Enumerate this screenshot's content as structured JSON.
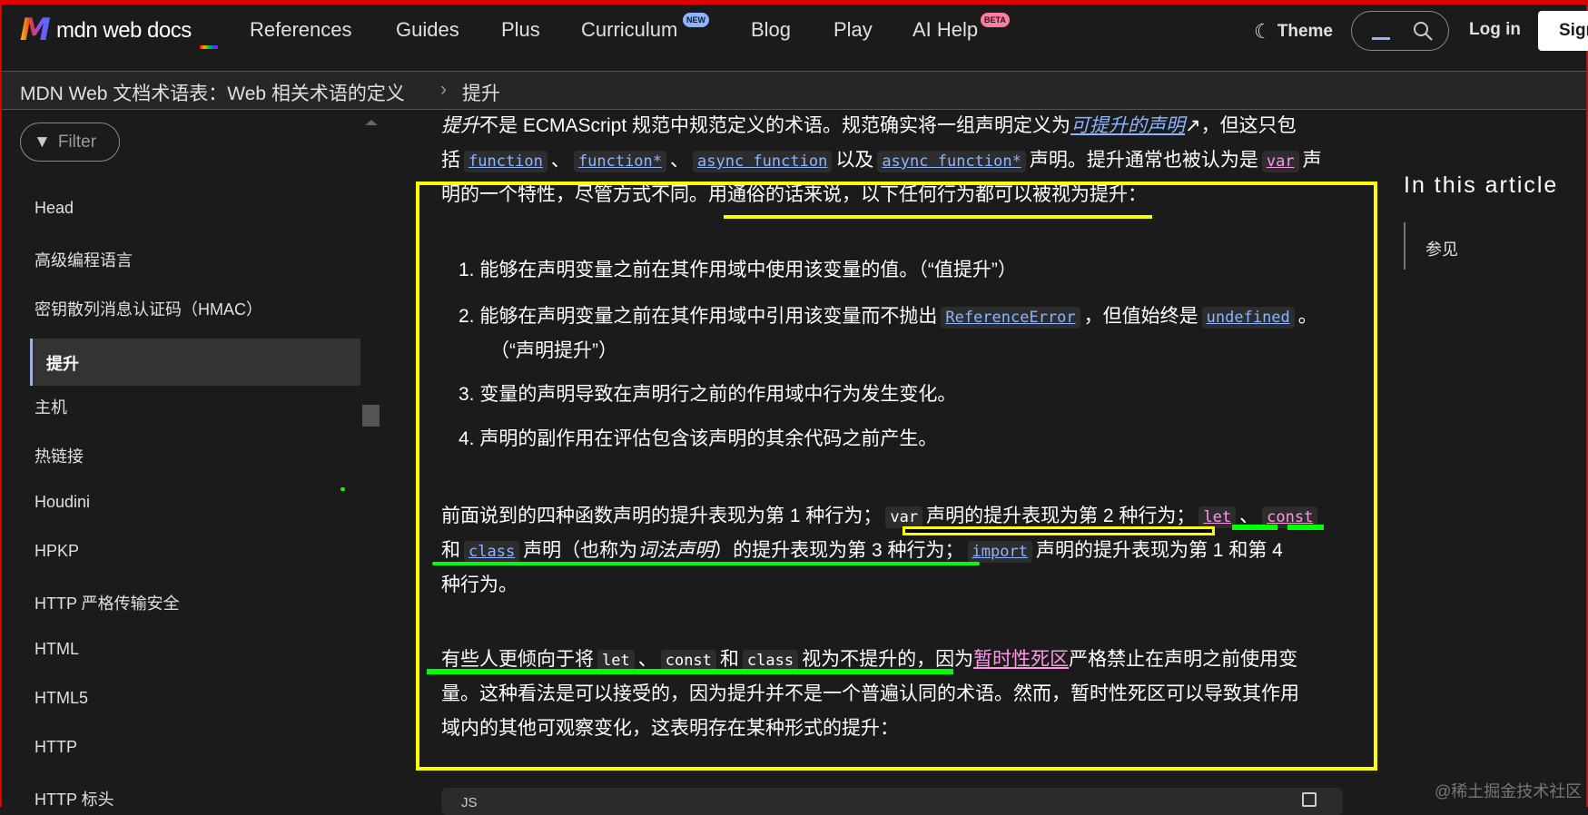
{
  "header": {
    "logo": "mdn web docs",
    "nav": [
      {
        "label": "References"
      },
      {
        "label": "Guides"
      },
      {
        "label": "Plus"
      },
      {
        "label": "Curriculum",
        "badge": "NEW"
      },
      {
        "label": "Blog"
      },
      {
        "label": "Play"
      },
      {
        "label": "AI Help",
        "badge": "BETA"
      }
    ],
    "theme_label": "Theme",
    "login_label": "Log in",
    "signup_label": "Sign"
  },
  "breadcrumb": {
    "parent": "MDN Web 文档术语表：Web 相关术语的定义",
    "separator": "›",
    "current": "提升"
  },
  "sidebar": {
    "filter_label": "Filter",
    "items": [
      "Head",
      "高级编程语言",
      "密钥散列消息认证码（HMAC）",
      "提升",
      "主机",
      "热链接",
      "Houdini",
      "HPKP",
      "HTTP 严格传输安全",
      "HTML",
      "HTML5",
      "HTTP",
      "HTTP 标头"
    ],
    "active_index": 3
  },
  "article": {
    "lines": [
      {
        "cls": "",
        "seg": [
          [
            "em",
            "提升"
          ],
          [
            "t",
            "不是 ECMAScript 规范中规范定义的术语。规范确实将一组声明定义为"
          ],
          [
            "link",
            "可提升的声明"
          ],
          [
            "t",
            "↗，但这只包"
          ]
        ]
      },
      {
        "cls": "",
        "seg": [
          [
            "t",
            "括"
          ],
          [
            "code-l",
            "function"
          ],
          [
            "t",
            "、"
          ],
          [
            "code-l",
            "function*"
          ],
          [
            "t",
            "、"
          ],
          [
            "code-l",
            "async function"
          ],
          [
            "t",
            "以及"
          ],
          [
            "code-l",
            "async function*"
          ],
          [
            "t",
            "声明。提升通常也被认为是"
          ],
          [
            "code-p",
            "var"
          ],
          [
            "t",
            "声"
          ]
        ]
      },
      {
        "cls": "",
        "seg": [
          [
            "t",
            "明的一个特性，尽管方式不同。用通俗的话来说，以下任何行为都可以被视为提升："
          ]
        ]
      },
      {
        "cls": "li",
        "seg": [
          [
            "t",
            "1. 能够在声明变量之前在其作用域中使用该变量的值。（“值提升”）"
          ]
        ]
      },
      {
        "cls": "li",
        "seg": [
          [
            "t",
            "2. 能够在声明变量之前在其作用域中引用该变量而不抛出"
          ],
          [
            "code-l",
            "ReferenceError"
          ],
          [
            "t",
            "，但值始终是"
          ],
          [
            "code-l",
            "undefined"
          ],
          [
            "t",
            "。"
          ]
        ]
      },
      {
        "cls": "li2",
        "seg": [
          [
            "t",
            "（“声明提升”）"
          ]
        ]
      },
      {
        "cls": "li",
        "seg": [
          [
            "t",
            "3. 变量的声明导致在声明行之前的作用域中行为发生变化。"
          ]
        ]
      },
      {
        "cls": "li",
        "seg": [
          [
            "t",
            "4. 声明的副作用在评估包含该声明的其余代码之前产生。"
          ]
        ]
      },
      {
        "cls": "",
        "seg": [
          [
            "t",
            "前面说到的四种函数声明的提升表现为第 1 种行为；"
          ],
          [
            "code-w",
            "var"
          ],
          [
            "t",
            "声明的提升表现为第 2 种行为；"
          ],
          [
            "code-p",
            "let"
          ],
          [
            "t",
            "、"
          ],
          [
            "code-p",
            "const"
          ]
        ]
      },
      {
        "cls": "",
        "seg": [
          [
            "t",
            "和"
          ],
          [
            "code-l",
            "class"
          ],
          [
            "t",
            "声明（也称为"
          ],
          [
            "em",
            "词法声明"
          ],
          [
            "t",
            "）的提升表现为第 3 种行为；"
          ],
          [
            "code-l",
            "import"
          ],
          [
            "t",
            "声明的提升表现为第 1 和第 4"
          ]
        ]
      },
      {
        "cls": "",
        "seg": [
          [
            "t",
            "种行为。"
          ]
        ]
      },
      {
        "cls": "",
        "seg": [
          [
            "t",
            "有些人更倾向于将"
          ],
          [
            "code-w",
            "let"
          ],
          [
            "t",
            "、"
          ],
          [
            "code-w",
            "const"
          ],
          [
            "t",
            "和"
          ],
          [
            "code-w",
            "class"
          ],
          [
            "t",
            "视为不提升的，因为"
          ],
          [
            "linkpink",
            "暂时性死区"
          ],
          [
            "t",
            "严格禁止在声明之前使用变"
          ]
        ]
      },
      {
        "cls": "",
        "seg": [
          [
            "t",
            "量。这种看法是可以接受的，因为提升并不是一个普遍认同的术语。然而，暂时性死区可以导致其作用"
          ]
        ]
      },
      {
        "cls": "",
        "seg": [
          [
            "t",
            "域内的其他可观察变化，这表明存在某种形式的提升："
          ]
        ]
      }
    ],
    "code_lang": "JS"
  },
  "toc": {
    "title": "In this article",
    "items": [
      "参见"
    ]
  },
  "watermark": "@稀土掘金技术社区",
  "colors": {
    "accent": "#8cb4ff",
    "pink": "#ff97e9",
    "annotation_yellow": "#ffff00",
    "annotation_green": "#00ff00"
  }
}
